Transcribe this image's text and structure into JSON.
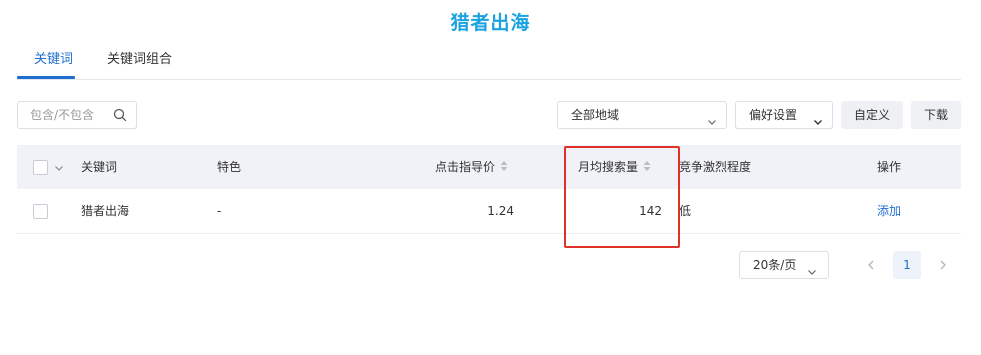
{
  "page": {
    "title": "猎者出海"
  },
  "tabs": [
    {
      "label": "关键词",
      "active": true
    },
    {
      "label": "关键词组合",
      "active": false
    }
  ],
  "toolbar": {
    "search_placeholder": "包含/不包含",
    "region_select": "全部地域",
    "preferences": "偏好设置",
    "customize": "自定义",
    "download": "下载"
  },
  "table": {
    "headers": {
      "keyword": "关键词",
      "feature": "特色",
      "suggested_bid": "点击指导价",
      "monthly_searches": "月均搜索量",
      "competition": "竞争激烈程度",
      "action": "操作"
    },
    "rows": [
      {
        "keyword": "猎者出海",
        "feature": "-",
        "suggested_bid": "1.24",
        "monthly_searches": "142",
        "competition": "低",
        "action": "添加"
      }
    ]
  },
  "pagination": {
    "page_size": "20条/页",
    "current_page": "1"
  },
  "colors": {
    "accent": "#1f6fd1",
    "title": "#1aa3e0",
    "highlight_box": "#e0302a"
  }
}
